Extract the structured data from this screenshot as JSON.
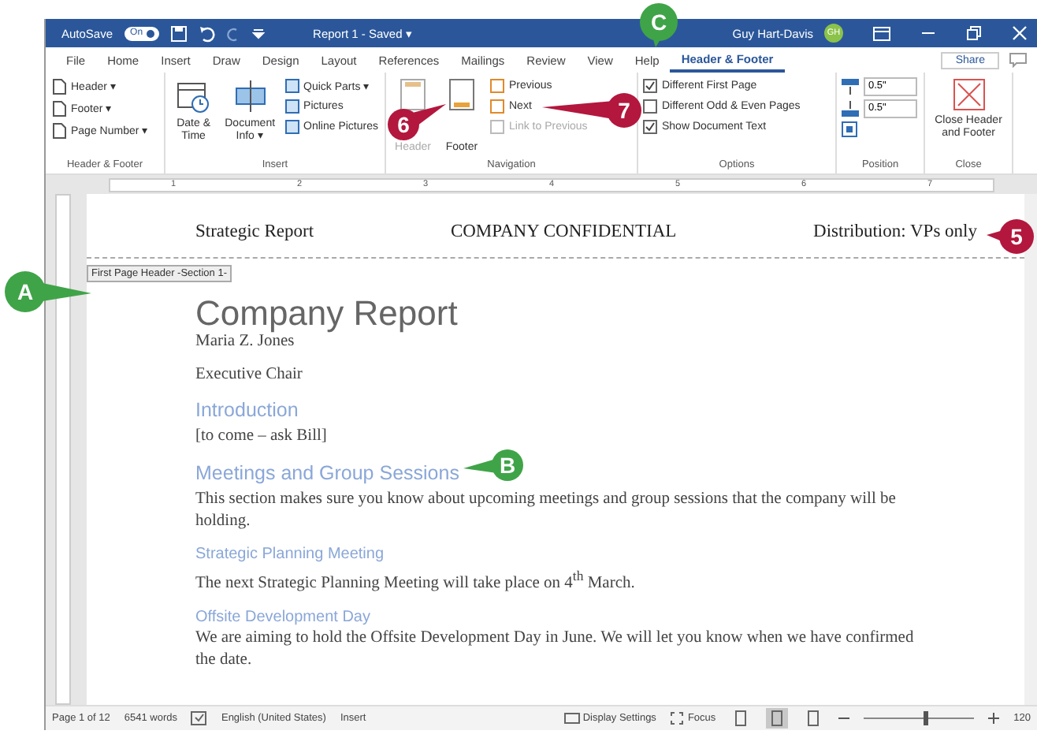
{
  "title_bar": {
    "autosave_label": "AutoSave",
    "autosave_toggle": {
      "label": "On",
      "on": true
    },
    "document_title": "Report 1 - Saved ▾",
    "user_name": "Guy Hart-Davis",
    "user_initials": "GH"
  },
  "menu_tabs": [
    {
      "label": "File",
      "selected": false
    },
    {
      "label": "Home",
      "selected": false
    },
    {
      "label": "Insert",
      "selected": false
    },
    {
      "label": "Draw",
      "selected": false
    },
    {
      "label": "Design",
      "selected": false
    },
    {
      "label": "Layout",
      "selected": false
    },
    {
      "label": "References",
      "selected": false
    },
    {
      "label": "Mailings",
      "selected": false
    },
    {
      "label": "Review",
      "selected": false
    },
    {
      "label": "View",
      "selected": false
    },
    {
      "label": "Help",
      "selected": false
    },
    {
      "label": "Header & Footer",
      "selected": true
    }
  ],
  "share_label": "Share",
  "ribbon": {
    "header_footer": {
      "items": [
        "Header ▾",
        "Footer ▾",
        "Page Number ▾"
      ],
      "group_label": "Header & Footer"
    },
    "insert": {
      "big": [
        "Date & Time",
        "Document Info ▾"
      ],
      "small": [
        "Quick Parts ▾",
        "Pictures",
        "Online Pictures"
      ],
      "group_label": "Insert"
    },
    "navigation": {
      "big": [
        {
          "label": "Header",
          "disabled": true
        },
        {
          "label": "Footer",
          "disabled": false
        }
      ],
      "small": [
        {
          "label": "Previous",
          "disabled": false
        },
        {
          "label": "Next",
          "disabled": false
        },
        {
          "label": "Link to Previous",
          "disabled": true
        }
      ],
      "group_label": "Navigation"
    },
    "options": {
      "items": [
        {
          "label": "Different First Page",
          "checked": true
        },
        {
          "label": "Different Odd & Even Pages",
          "checked": false
        },
        {
          "label": "Show Document Text",
          "checked": true
        }
      ],
      "group_label": "Options"
    },
    "position": {
      "header_value": "0.5\"",
      "footer_value": "0.5\"",
      "group_label": "Position"
    },
    "close": {
      "button": "Close Header and Footer",
      "group_label": "Close"
    }
  },
  "ruler_numbers": [
    "1",
    "2",
    "3",
    "4",
    "5",
    "6",
    "7"
  ],
  "document": {
    "header_tag": "First Page Header -Section 1-",
    "header": [
      "Strategic Report",
      "COMPANY CONFIDENTIAL",
      "Distribution: VPs only"
    ],
    "paragraphs": [
      {
        "kind": "title",
        "text": "Company Report"
      },
      {
        "kind": "normal",
        "text": "Maria Z. Jones"
      },
      {
        "kind": "normal",
        "text": "Executive Chair"
      },
      {
        "kind": "heading1",
        "text": "Introduction"
      },
      {
        "kind": "body",
        "text": "[to come – ask Bill]"
      },
      {
        "kind": "heading1",
        "text": "Meetings and Group Sessions"
      },
      {
        "kind": "body",
        "text": "This section makes sure you know about upcoming meetings and group sessions that the company will be holding."
      },
      {
        "kind": "heading2",
        "text": "Strategic Planning Meeting"
      },
      {
        "kind": "body",
        "text": "The next Strategic Planning Meeting will take place on 4$^{th}$ March."
      },
      {
        "kind": "heading2",
        "text": "Offsite Development Day"
      },
      {
        "kind": "body",
        "text": "We are aiming to hold the Offsite Development Day in June. We will let you know when we have confirmed the date."
      }
    ]
  },
  "status_bar": {
    "page": "Page 1 of 12",
    "words": "6541 words",
    "language": "English (United States)",
    "mode": "Insert",
    "display_settings": "Display Settings",
    "focus": "Focus",
    "views": [
      {
        "selected": false
      },
      {
        "selected": true
      },
      {
        "selected": false
      }
    ],
    "zoom": {
      "level": 0.55
    },
    "zoom_percent": "120"
  },
  "callouts": [
    {
      "label": "C",
      "color": "#3fa448"
    },
    {
      "label": "6",
      "color": "#b3173d"
    },
    {
      "label": "7",
      "color": "#b3173d"
    },
    {
      "label": "5",
      "color": "#b3173d"
    },
    {
      "label": "A",
      "color": "#3fa448"
    },
    {
      "label": "B",
      "color": "#3fa448"
    }
  ]
}
